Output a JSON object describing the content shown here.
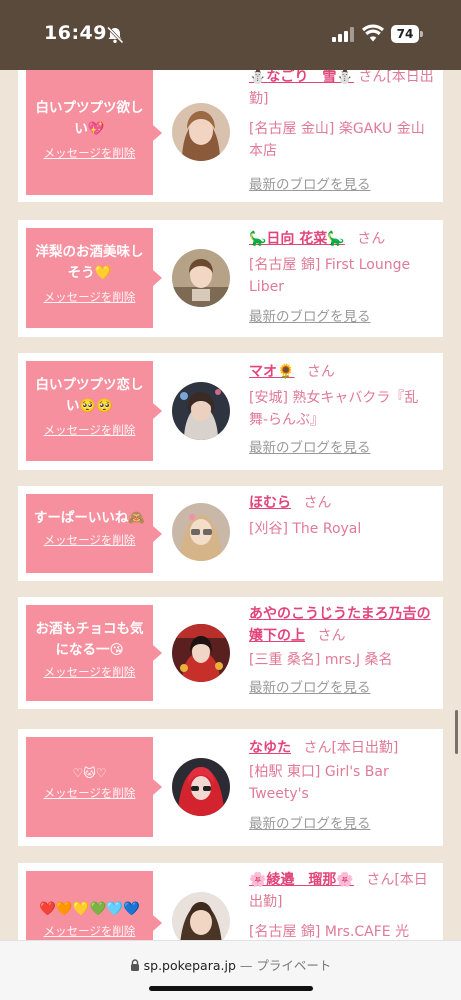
{
  "status": {
    "time": "16:49",
    "battery": "74"
  },
  "browser": {
    "url": "sp.pokepara.jp",
    "separator": " — ",
    "mode": "プライベート"
  },
  "common": {
    "delete_label": "メッセージを削除",
    "honorific": "さん",
    "blog_label": "最新のブログを見る"
  },
  "items": [
    {
      "message": "白いプツプツ欲しい💖",
      "name": "⛄️なごり　雪⛄️",
      "status_tag": "[本日出勤]",
      "shop": "[名古屋 金山] 楽GAKU 金山本店"
    },
    {
      "message": "洋梨のお酒美味しそう💛",
      "name": "🦕日向 花菜🦕",
      "status_tag": "",
      "shop": "[名古屋 錦] First Lounge Liber"
    },
    {
      "message": "白いプツプツ恋しい🥺🥺",
      "name": "マオ🌻",
      "status_tag": "",
      "shop": "[安城] 熟女キャバクラ『乱舞-らんぶ』"
    },
    {
      "message": "すーぱーいいね🙈",
      "name": "ほむら",
      "status_tag": "",
      "shop": "[刈谷] The Royal"
    },
    {
      "message": "お酒もチョコも気になる一😘",
      "name": "あやのこうじうたまろ乃𠮷の嬢下の上",
      "status_tag": "",
      "shop": "[三重 桑名] mrs.J 桑名"
    },
    {
      "message": "♡🐱♡",
      "name": "なゆた",
      "status_tag": "[本日出勤]",
      "shop": "[柏駅 東口] Girl's Bar Tweety's"
    },
    {
      "message": "❤️🧡💛💚🩵💙",
      "name": "🌸綾邉　瑠那🌸",
      "status_tag": "[本日出勤]",
      "shop": "[名古屋 錦] Mrs.CAFE 光"
    }
  ]
}
